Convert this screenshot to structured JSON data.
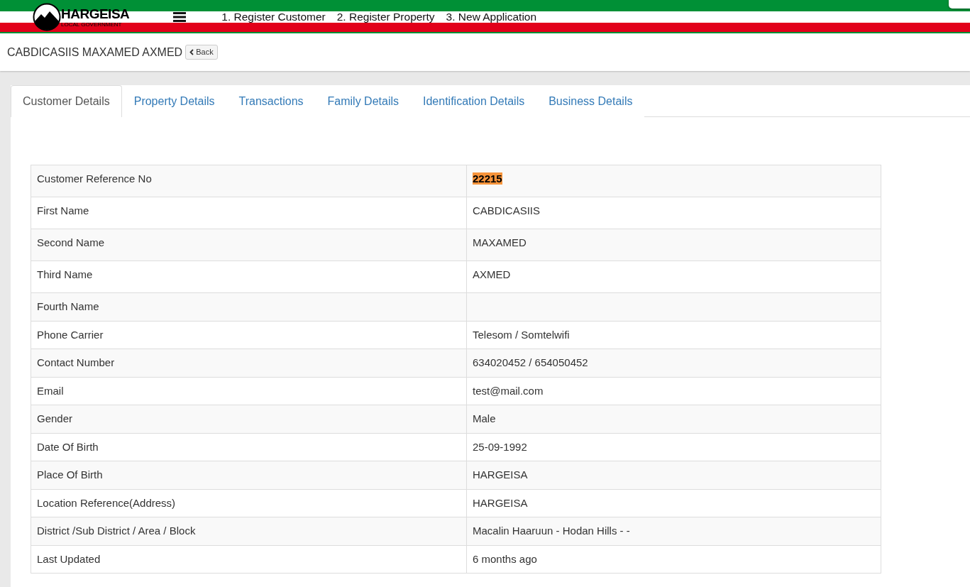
{
  "header": {
    "logo_title": "HARGEISA",
    "logo_subtitle": "LOCAL GOVERNMENT",
    "nav_links": [
      "1. Register Customer",
      "2. Register Property",
      "3. New Application"
    ]
  },
  "page": {
    "title": "CABDICASIIS MAXAMED AXMED",
    "back_button": "Back"
  },
  "tabs": [
    {
      "label": "Customer Details",
      "selected": true
    },
    {
      "label": "Property Details",
      "selected": false
    },
    {
      "label": "Transactions",
      "selected": false
    },
    {
      "label": "Family Details",
      "selected": false
    },
    {
      "label": "Identification Details",
      "selected": false
    },
    {
      "label": "Business Details",
      "selected": false
    }
  ],
  "details": [
    {
      "label": "Customer Reference No",
      "value": "22215",
      "highlighted": true
    },
    {
      "label": "First Name",
      "value": "CABDICASIIS",
      "highlighted": false
    },
    {
      "label": "Second Name",
      "value": "MAXAMED",
      "highlighted": false
    },
    {
      "label": "Third Name",
      "value": "AXMED",
      "highlighted": false
    },
    {
      "label": "Fourth Name",
      "highlighted": false
    },
    {
      "label": "Phone Carrier",
      "value": "Telesom / Somtelwifi",
      "highlighted": false
    },
    {
      "label": "Contact Number",
      "value": "634020452 / 654050452",
      "highlighted": false
    },
    {
      "label": "Email",
      "value": "test@mail.com",
      "highlighted": false
    },
    {
      "label": "Gender",
      "value": "Male",
      "highlighted": false
    },
    {
      "label": "Date Of Birth",
      "value": "25-09-1992",
      "highlighted": false
    },
    {
      "label": "Place Of Birth",
      "value": "HARGEISA",
      "highlighted": false
    },
    {
      "label": "Location Reference(Address)",
      "value": "HARGEISA",
      "highlighted": false
    },
    {
      "label": "District /Sub District / Area / Block",
      "value": "Macalin Haaruun - Hodan Hills - -",
      "highlighted": false
    },
    {
      "label": "Last Updated",
      "value": "6 months ago",
      "highlighted": false
    }
  ]
}
